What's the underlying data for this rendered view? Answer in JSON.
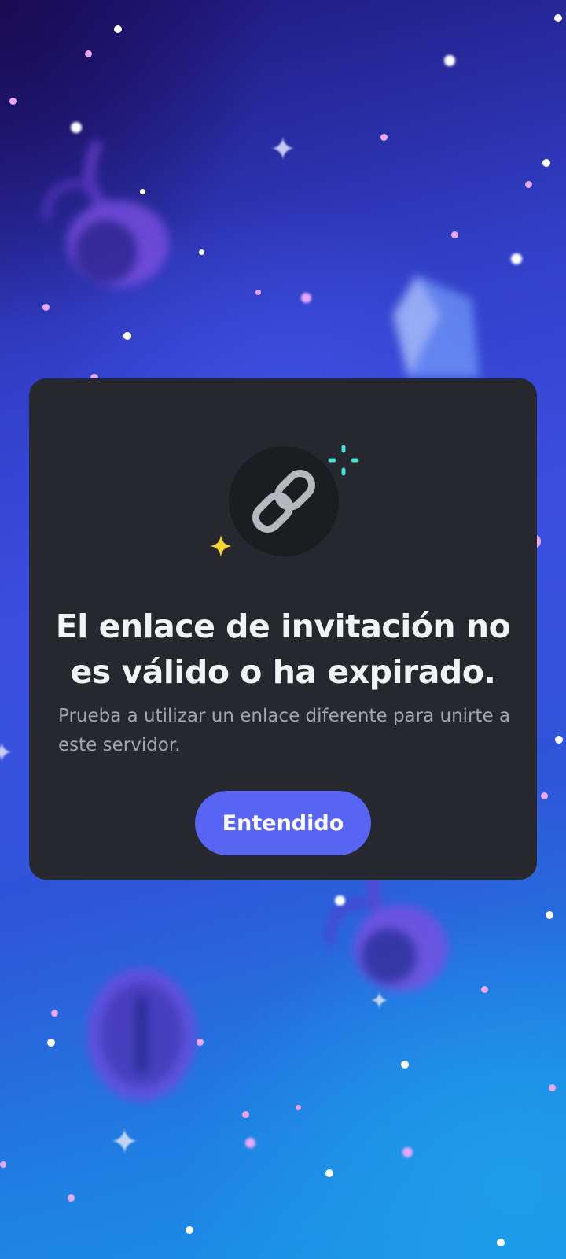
{
  "dialog": {
    "icon": "link-icon",
    "decorations": [
      "sparkle-yellow-icon",
      "sparkle-cyan-icon"
    ],
    "title": "El enlace de invitación no es válido o ha expirado.",
    "message": "Prueba a utilizar un enlace diferente para unirte a este servidor.",
    "confirm_label": "Entendido"
  },
  "colors": {
    "dialog_bg": "#27282e",
    "button_bg": "#5865f2",
    "title_text": "#f2f3f5",
    "body_text": "#a3a6ad",
    "sparkle_yellow": "#fcd535",
    "sparkle_cyan": "#45e0d6"
  }
}
